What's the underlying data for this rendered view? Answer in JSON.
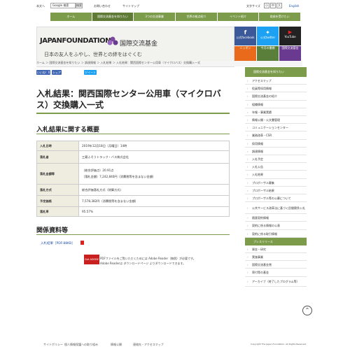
{
  "topbar": {
    "lang": "本文へ",
    "search_btn": "Google 検索",
    "search_btn2": "検索",
    "help": "お問い合わせ",
    "sitemap": "サイトマップ",
    "fontsize": "文字サイズ",
    "fs": [
      "小",
      "中",
      "大"
    ],
    "english": "English"
  },
  "nav": [
    "ホーム",
    "国際交流基金を知りたい",
    "3つの交流事業",
    "世界の拠点紹介",
    "イベント紹介",
    "助成を受けたい"
  ],
  "banner": {
    "jf": "JAPANFOUNDATION",
    "kk": "国際交流基金",
    "sub": "日本の友人をふやし、世界との絆をはぐくむ"
  },
  "tiles": [
    "公式facebook",
    "公式twitter",
    "YouTube",
    "ニッポン",
    "今月の書棚",
    "国際交流基金"
  ],
  "crumb": "ホーム ＞ 国際交流基金を知りたい ＞ 調達情報 ＞ 入札結果 ＞ 入札結果：関西国際センター公用車（マイクロバス）交換購入一式",
  "share": {
    "like": "いいね！0",
    "share": "シェア",
    "tweet": "ツイート"
  },
  "title": "入札結果：関西国際センター公用車（マイクロバス）交換購入一式",
  "h2a": "入札結果に関する概要",
  "table": [
    {
      "k": "入札日時",
      "v": [
        "2019年12月18日（月曜日）14時"
      ]
    },
    {
      "k": "落札者",
      "v": [
        "三菱ふそうトラック・バス株式会社"
      ]
    },
    {
      "k": "落札金額等",
      "v": [
        "（総合評価点）20.91点",
        "（落札金額）7,242,840円（消費税等を含まない金額）"
      ]
    },
    {
      "k": "落札方式",
      "v": [
        "総合評価落札方式（除算方式）"
      ]
    },
    {
      "k": "予定価格",
      "v": [
        "7,578,382円（消費税等を含まない金額）"
      ]
    },
    {
      "k": "落札率",
      "v": [
        "95.57%"
      ]
    }
  ],
  "h2b": "関係資料等",
  "pdf": "入札結果［PDF:88KB］",
  "adobe": {
    "badge": "Get ADOBE READER",
    "l1": "PDFファイルをご覧いただくためには Adobe Reader（無償）が必要です。",
    "l2": "Adobe Readerは ダウンロードページ よりダウンロードできます。"
  },
  "sidebar": {
    "header": "国際交流基金を知りたい",
    "items": [
      "アクセスマップ",
      "役員等採用情報",
      "国際交流基金の紹介",
      "組織情報",
      "年報・事業実績",
      "情報公開・公文書管理",
      "コミュニケーションセンター",
      "業務改革・CSR",
      "採用情報",
      "調達情報",
      "入札予定",
      "入札公告",
      "入札結果",
      "プロポーザル募集",
      "プロポーザル結果",
      "プロポーザル等の公募について",
      "公共サービス改革法に基づく民間競争入札実施について",
      "随意契約情報",
      "契約に係る情報の公表",
      "契約に係る取引情報"
    ],
    "header2": "プレスリリース",
    "items2": [
      "資金・研究",
      "実施事業",
      "国際交流基金賞",
      "寄付等の基金",
      "アーカイブ（終了したプログラム等）"
    ]
  },
  "footer": [
    "サイトポリシー",
    "個人情報保護への取り組み",
    "情報公開",
    "連絡先・アクセスマップ",
    "Copyright The Japan Foundation, All Rights Reserved."
  ],
  "colors": {
    "accent": "#7c9c4c",
    "accent_dark": "#5e7a35",
    "link": "#1a4ea0"
  }
}
